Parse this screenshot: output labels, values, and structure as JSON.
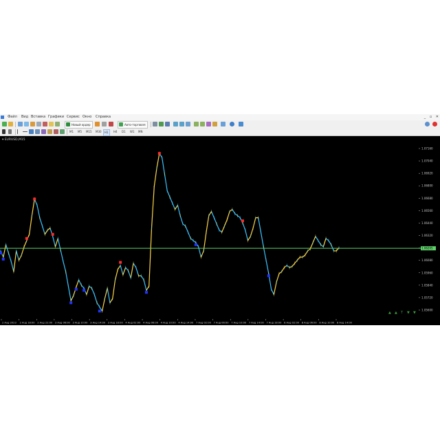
{
  "menu": [
    "Файл",
    "Вид",
    "Вставка",
    "Графики",
    "Сервис",
    "Окно",
    "Справка"
  ],
  "window_controls": [
    "_",
    "▫",
    "✕"
  ],
  "toolbar": {
    "new_order_label": "Новый ордер",
    "autotrading_label": "Авто-торговля"
  },
  "timeframes": [
    "M1",
    "M5",
    "M15",
    "M30",
    "H1",
    "H4",
    "D1",
    "W1",
    "MN"
  ],
  "active_timeframe": "M15",
  "chart": {
    "title": "▾ EURUSD,M15",
    "current_price_label": "1.06205",
    "corner_marks": [
      "▲",
      "▲",
      "T",
      "▼",
      "▼"
    ],
    "colors": {
      "background": "#000000",
      "up": "#ffd84a",
      "down": "#3cc4ff",
      "marker_high": "#ff2a2a",
      "marker_low": "#2233ff",
      "price_line": "#5fd26a",
      "grid_text": "#c8c8c8"
    },
    "y_ticks": [
      "1.07160",
      "1.07040",
      "1.06920",
      "1.06800",
      "1.06680",
      "1.06560",
      "1.06440",
      "1.06320",
      "1.06200",
      "1.06080",
      "1.05960",
      "1.05840",
      "1.05720",
      "1.05600"
    ],
    "x_ticks": [
      "2 Aug 2023",
      "2 Aug 18:00",
      "2 Aug 22:00",
      "3 Aug 06:00",
      "3 Aug 10:00",
      "3 Aug 14:00",
      "3 Aug 18:00",
      "4 Aug 02:00",
      "4 Aug 06:00",
      "4 Aug 10:00",
      "4 Aug 14:00",
      "7 Aug 02:00",
      "7 Aug 06:00",
      "7 Aug 10:00",
      "7 Aug 14:00",
      "7 Aug 18:00",
      "8 Aug 02:00",
      "8 Aug 06:00",
      "8 Aug 10:00",
      "8 Aug 14:00"
    ]
  },
  "chart_data": {
    "type": "line",
    "title": "EURUSD,M15",
    "xlabel": "",
    "ylabel": "",
    "ylim": [
      1.0555,
      1.0722
    ],
    "current_price": 1.06205,
    "series": [
      {
        "values": [
          1.0618,
          1.0612,
          1.0624,
          1.0616,
          1.0608,
          1.0598,
          1.0618,
          1.0609,
          1.0614,
          1.0622,
          1.0628,
          1.0634,
          1.0652,
          1.0668,
          1.0662,
          1.065,
          1.0642,
          1.0634,
          1.0638,
          1.064,
          1.0632,
          1.0622,
          1.063,
          1.0619,
          1.0608,
          1.0598,
          1.0584,
          1.057,
          1.0575,
          1.0583,
          1.059,
          1.0585,
          1.0582,
          1.0576,
          1.0584,
          1.0582,
          1.0576,
          1.0568,
          1.0564,
          1.056,
          1.0572,
          1.0582,
          1.0568,
          1.0572,
          1.059,
          1.06,
          1.0604,
          1.0595,
          1.0602,
          1.0599,
          1.0592,
          1.0606,
          1.0602,
          1.0594,
          1.0594,
          1.059,
          1.058,
          1.0584,
          1.064,
          1.068,
          1.0698,
          1.0712,
          1.0708,
          1.0692,
          1.0676,
          1.067,
          1.0664,
          1.0658,
          1.0662,
          1.0652,
          1.0644,
          1.0642,
          1.0636,
          1.063,
          1.0628,
          1.0626,
          1.0622,
          1.0612,
          1.0618,
          1.0636,
          1.0652,
          1.0656,
          1.065,
          1.0644,
          1.0638,
          1.0636,
          1.0642,
          1.0648,
          1.0656,
          1.0658,
          1.0654,
          1.0652,
          1.065,
          1.0645,
          1.0638,
          1.0628,
          1.0632,
          1.064,
          1.065,
          1.065,
          1.0636,
          1.0622,
          1.0609,
          1.0596,
          1.0581,
          1.0576,
          1.0588,
          1.0596,
          1.0598,
          1.0602,
          1.0604,
          1.0602,
          1.0603,
          1.0606,
          1.0609,
          1.0612,
          1.0612,
          1.0614,
          1.0618,
          1.062,
          1.0626,
          1.0632,
          1.0628,
          1.0624,
          1.0622,
          1.063,
          1.0628,
          1.0624,
          1.0618,
          1.0618,
          1.0621
        ]
      }
    ],
    "markers_high": [
      1.0666,
      1.0605,
      1.071,
      1.0645,
      1.0628,
      1.0632
    ],
    "markers_low": [
      1.0596,
      1.0582,
      1.057,
      1.0562,
      1.058,
      1.0612,
      1.0626,
      1.0618,
      1.0583
    ]
  }
}
